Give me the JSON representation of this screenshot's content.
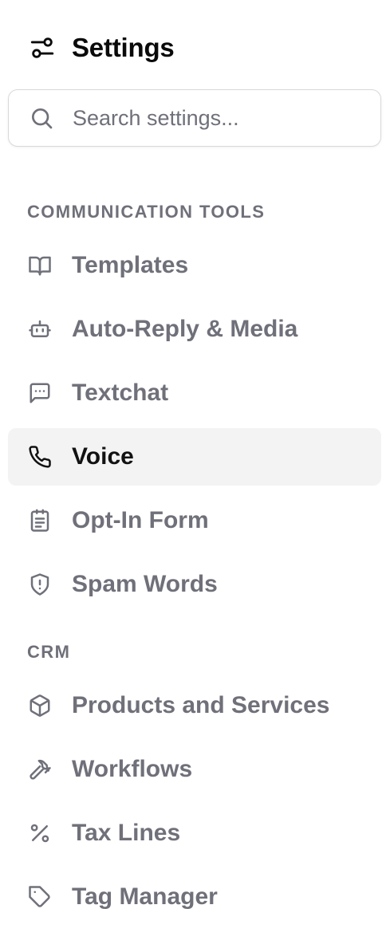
{
  "header": {
    "title": "Settings",
    "icon": "sliders-icon"
  },
  "search": {
    "placeholder": "Search settings...",
    "value": "",
    "icon": "search-icon"
  },
  "sections": [
    {
      "title": "COMMUNICATION TOOLS",
      "items": [
        {
          "label": "Templates",
          "icon": "book-open-icon",
          "active": false
        },
        {
          "label": "Auto-Reply & Media",
          "icon": "bot-icon",
          "active": false
        },
        {
          "label": "Textchat",
          "icon": "message-square-dots-icon",
          "active": false
        },
        {
          "label": "Voice",
          "icon": "phone-icon",
          "active": true
        },
        {
          "label": "Opt-In Form",
          "icon": "clipboard-list-icon",
          "active": false
        },
        {
          "label": "Spam Words",
          "icon": "shield-alert-icon",
          "active": false
        }
      ]
    },
    {
      "title": "CRM",
      "items": [
        {
          "label": "Products and Services",
          "icon": "package-icon",
          "active": false
        },
        {
          "label": "Workflows",
          "icon": "hammer-icon",
          "active": false
        },
        {
          "label": "Tax Lines",
          "icon": "percent-icon",
          "active": false
        },
        {
          "label": "Tag Manager",
          "icon": "tag-icon",
          "active": false
        }
      ]
    }
  ],
  "colors": {
    "muted_text": "#6f7079",
    "active_text": "#121212",
    "active_bg": "#f3f3f4",
    "border": "#d9d9dc"
  }
}
